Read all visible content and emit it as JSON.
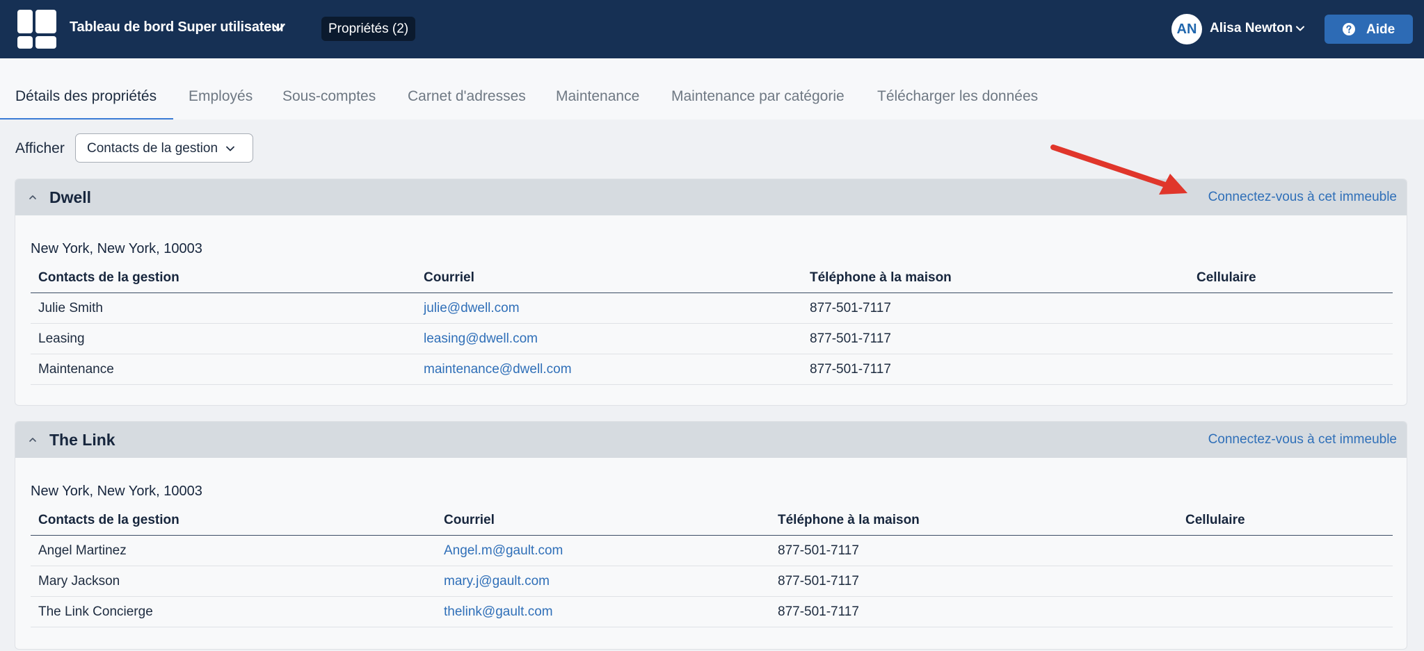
{
  "header": {
    "dashboard_title": "Tableau de bord Super utilisateur",
    "properties_button": "Propriétés (2)",
    "user_initials": "AN",
    "user_name": "Alisa Newton",
    "help_label": "Aide"
  },
  "tabs": [
    {
      "label": "Détails des propriétés",
      "active": true
    },
    {
      "label": "Employés"
    },
    {
      "label": "Sous-comptes"
    },
    {
      "label": "Carnet d'adresses"
    },
    {
      "label": "Maintenance"
    },
    {
      "label": "Maintenance par catégorie"
    },
    {
      "label": "Télécharger les données"
    }
  ],
  "filter": {
    "label": "Afficher",
    "value": "Contacts de la gestion"
  },
  "colors": {
    "topbar": "#163054",
    "accent": "#2d6bb5",
    "link": "#2f6fb8",
    "annotation_arrow": "#e0362b"
  },
  "properties": [
    {
      "name": "Dwell",
      "connect_link": "Connectez-vous à cet immeuble",
      "address": "New York, New York, 10003",
      "columns": [
        "Contacts de la gestion",
        "Courriel",
        "Téléphone à la maison",
        "Cellulaire"
      ],
      "rows": [
        {
          "contact": "Julie Smith",
          "email": "julie@dwell.com",
          "home_phone": "877-501-7117",
          "cell": ""
        },
        {
          "contact": "Leasing",
          "email": "leasing@dwell.com",
          "home_phone": "877-501-7117",
          "cell": ""
        },
        {
          "contact": "Maintenance",
          "email": "maintenance@dwell.com",
          "home_phone": "877-501-7117",
          "cell": ""
        }
      ]
    },
    {
      "name": "The Link",
      "connect_link": "Connectez-vous à cet immeuble",
      "address": "New York, New York, 10003",
      "columns": [
        "Contacts de la gestion",
        "Courriel",
        "Téléphone à la maison",
        "Cellulaire"
      ],
      "rows": [
        {
          "contact": "Angel Martinez",
          "email": "Angel.m@gault.com",
          "home_phone": "877-501-7117",
          "cell": ""
        },
        {
          "contact": "Mary Jackson",
          "email": "mary.j@gault.com",
          "home_phone": "877-501-7117",
          "cell": ""
        },
        {
          "contact": "The Link Concierge",
          "email": "thelink@gault.com",
          "home_phone": "877-501-7117",
          "cell": ""
        }
      ]
    }
  ]
}
